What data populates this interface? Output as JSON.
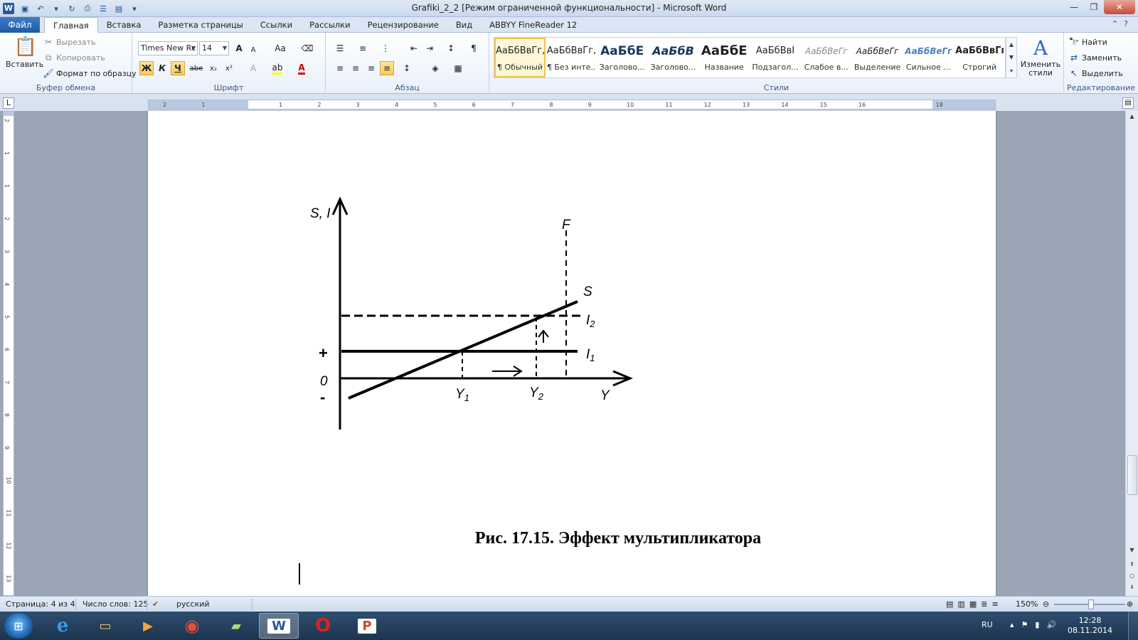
{
  "window": {
    "title": "Grafiki_2_2 [Режим ограниченной функциональности]  -  Microsoft Word"
  },
  "tabs": {
    "file": "Файл",
    "items": [
      "Главная",
      "Вставка",
      "Разметка страницы",
      "Ссылки",
      "Рассылки",
      "Рецензирование",
      "Вид",
      "ABBYY FineReader 12"
    ]
  },
  "clipboard": {
    "paste": "Вставить",
    "cut": "Вырезать",
    "copy": "Копировать",
    "format_painter": "Формат по образцу",
    "label": "Буфер обмена"
  },
  "font": {
    "name": "Times New Rc",
    "size": "14",
    "bold": "Ж",
    "italic": "К",
    "underline": "Ч",
    "strike": "abe",
    "sub": "x₂",
    "sup": "x²",
    "grow": "A",
    "shrink": "A",
    "case": "Aa",
    "label": "Шрифт"
  },
  "paragraph": {
    "label": "Абзац",
    "pilcrow": "¶"
  },
  "styles": {
    "label": "Стили",
    "items": [
      {
        "preview": "АаБбВвГг,",
        "name": "¶ Обычный"
      },
      {
        "preview": "АаБбВвГг,",
        "name": "¶ Без инте..."
      },
      {
        "preview": "АаБбЕ",
        "name": "Заголово..."
      },
      {
        "preview": "АаБбВ",
        "name": "Заголово..."
      },
      {
        "preview": "АаБбЕ",
        "name": "Название"
      },
      {
        "preview": "АаБбВвІ",
        "name": "Подзагол..."
      },
      {
        "preview": "АаБбВеГг",
        "name": "Слабое в..."
      },
      {
        "preview": "АаБбВеГг",
        "name": "Выделение"
      },
      {
        "preview": "АаБбВеГг",
        "name": "Сильное ..."
      },
      {
        "preview": "АаБбВвГг,",
        "name": "Строгий"
      }
    ],
    "change": "Изменить стили"
  },
  "editing": {
    "find": "Найти",
    "replace": "Заменить",
    "select": "Выделить",
    "label": "Редактирование"
  },
  "ruler": {
    "h_ticks": [
      "2",
      "1",
      "",
      "1",
      "2",
      "3",
      "4",
      "5",
      "6",
      "7",
      "8",
      "9",
      "10",
      "11",
      "12",
      "13",
      "14",
      "15",
      "16",
      "",
      "18"
    ],
    "v_ticks": [
      "2",
      "1",
      "1",
      "2",
      "3",
      "4",
      "5",
      "6",
      "7",
      "8",
      "9",
      "10",
      "11",
      "12",
      "13"
    ]
  },
  "graph": {
    "y_axis_label": "S, I",
    "x_axis_label": "Y",
    "plus": "+",
    "zero": "0",
    "minus": "-",
    "f_label": "F",
    "s_label": "S",
    "i1_label": "I",
    "i1_sub": "1",
    "i2_label": "I",
    "i2_sub": "2",
    "y1_label": "Y",
    "y1_sub": "1",
    "y2_label": "Y",
    "y2_sub": "2"
  },
  "caption": "Рис. 17.15. Эффект мультипликатора",
  "status": {
    "page": "Страница: 4 из 4",
    "words": "Число слов: 125",
    "language": "русский",
    "zoom": "150%"
  },
  "taskbar": {
    "lang": "RU",
    "time": "12:28",
    "date": "08.11.2014"
  }
}
